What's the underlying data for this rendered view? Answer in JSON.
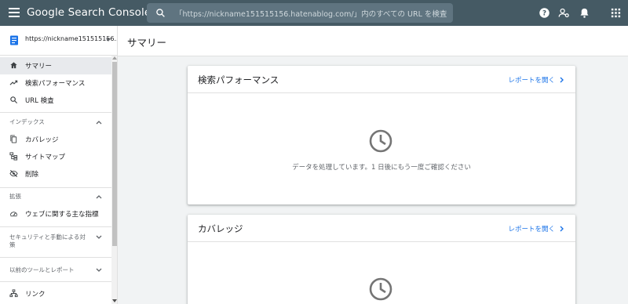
{
  "app": {
    "brand": "Google Search Console",
    "search_placeholder": "「https://nickname151515156.hatenablog.com/」内のすべての URL を検査"
  },
  "top_icons": [
    "help-icon",
    "manage-users-icon",
    "notifications-icon",
    "apps-grid-icon"
  ],
  "sidebar": {
    "property": "https://nickname151515156...",
    "items": [
      {
        "label": "サマリー",
        "icon": "home-icon",
        "active": true
      },
      {
        "label": "検索パフォーマンス",
        "icon": "trending-up-icon"
      },
      {
        "label": "URL 検査",
        "icon": "search-icon"
      }
    ],
    "sections": [
      {
        "label": "インデックス",
        "items": [
          {
            "label": "カバレッジ",
            "icon": "copy-icon"
          },
          {
            "label": "サイトマップ",
            "icon": "sitemap-icon"
          },
          {
            "label": "削除",
            "icon": "eye-off-icon"
          }
        ]
      },
      {
        "label": "拡張",
        "items": [
          {
            "label": "ウェブに関する主な指標",
            "icon": "speed-icon"
          }
        ]
      },
      {
        "label": "セキュリティと手動による対策"
      },
      {
        "label": "以前のツールとレポート"
      }
    ],
    "bottom_item": {
      "label": "リンク",
      "icon": "links-icon"
    }
  },
  "main": {
    "title": "サマリー",
    "cards": [
      {
        "title": "検索パフォーマンス",
        "link": "レポートを開く",
        "message": "データを処理しています。1 日後にもう一度ご確認ください"
      },
      {
        "title": "カバレッジ",
        "link": "レポートを開く",
        "message": ""
      }
    ]
  },
  "colors": {
    "topbar": "#455a64",
    "link": "#1a73e8",
    "background": "#f1f3f4"
  }
}
